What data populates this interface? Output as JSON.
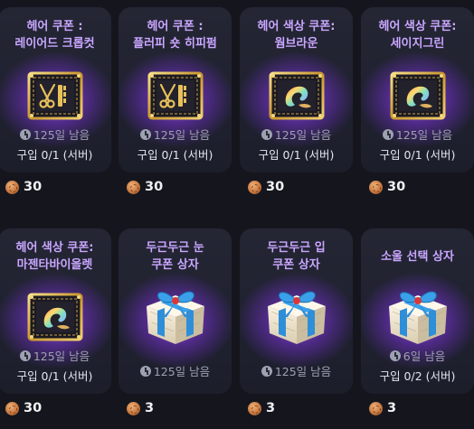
{
  "items": [
    {
      "title_lines": [
        "헤어 쿠폰 :",
        "레이어드 크롭컷"
      ],
      "art": "scissors-comb-coupon-icon",
      "remaining": "125일 남음",
      "purchase": "구입 0/1 (서버)",
      "price": "30"
    },
    {
      "title_lines": [
        "헤어 쿠폰 :",
        "플러피 숏 히피펌"
      ],
      "art": "scissors-comb-coupon-icon",
      "remaining": "125일 남음",
      "purchase": "구입 0/1 (서버)",
      "price": "30"
    },
    {
      "title_lines": [
        "헤어 색상 쿠폰:",
        "웜브라운"
      ],
      "art": "hair-color-coupon-icon",
      "remaining": "125일 남음",
      "purchase": "구입 0/1 (서버)",
      "price": "30"
    },
    {
      "title_lines": [
        "헤어 색상 쿠폰:",
        "세이지그린"
      ],
      "art": "hair-color-coupon-icon",
      "remaining": "125일 남음",
      "purchase": "구입 0/1 (서버)",
      "price": "30"
    },
    {
      "title_lines": [
        "헤어 색상 쿠폰:",
        "마젠타바이올렛"
      ],
      "art": "hair-color-coupon-icon",
      "remaining": "125일 남음",
      "purchase": "구입 0/1 (서버)",
      "price": "30"
    },
    {
      "title_lines": [
        "두근두근 눈",
        "쿠폰 상자"
      ],
      "art": "gift-box-icon",
      "remaining": "125일 남음",
      "purchase": "",
      "price": "3"
    },
    {
      "title_lines": [
        "두근두근 입",
        "쿠폰 상자"
      ],
      "art": "gift-box-icon",
      "remaining": "125일 남음",
      "purchase": "",
      "price": "3"
    },
    {
      "title_lines": [
        "소울 선택 상자"
      ],
      "art": "gift-box-icon",
      "remaining": "6일 남음",
      "purchase": "구입 0/2 (서버)",
      "price": "3"
    }
  ],
  "colors": {
    "title": "#c9a6ff",
    "glow": "#b060ff",
    "background": "#15161d",
    "card": "#222433"
  }
}
